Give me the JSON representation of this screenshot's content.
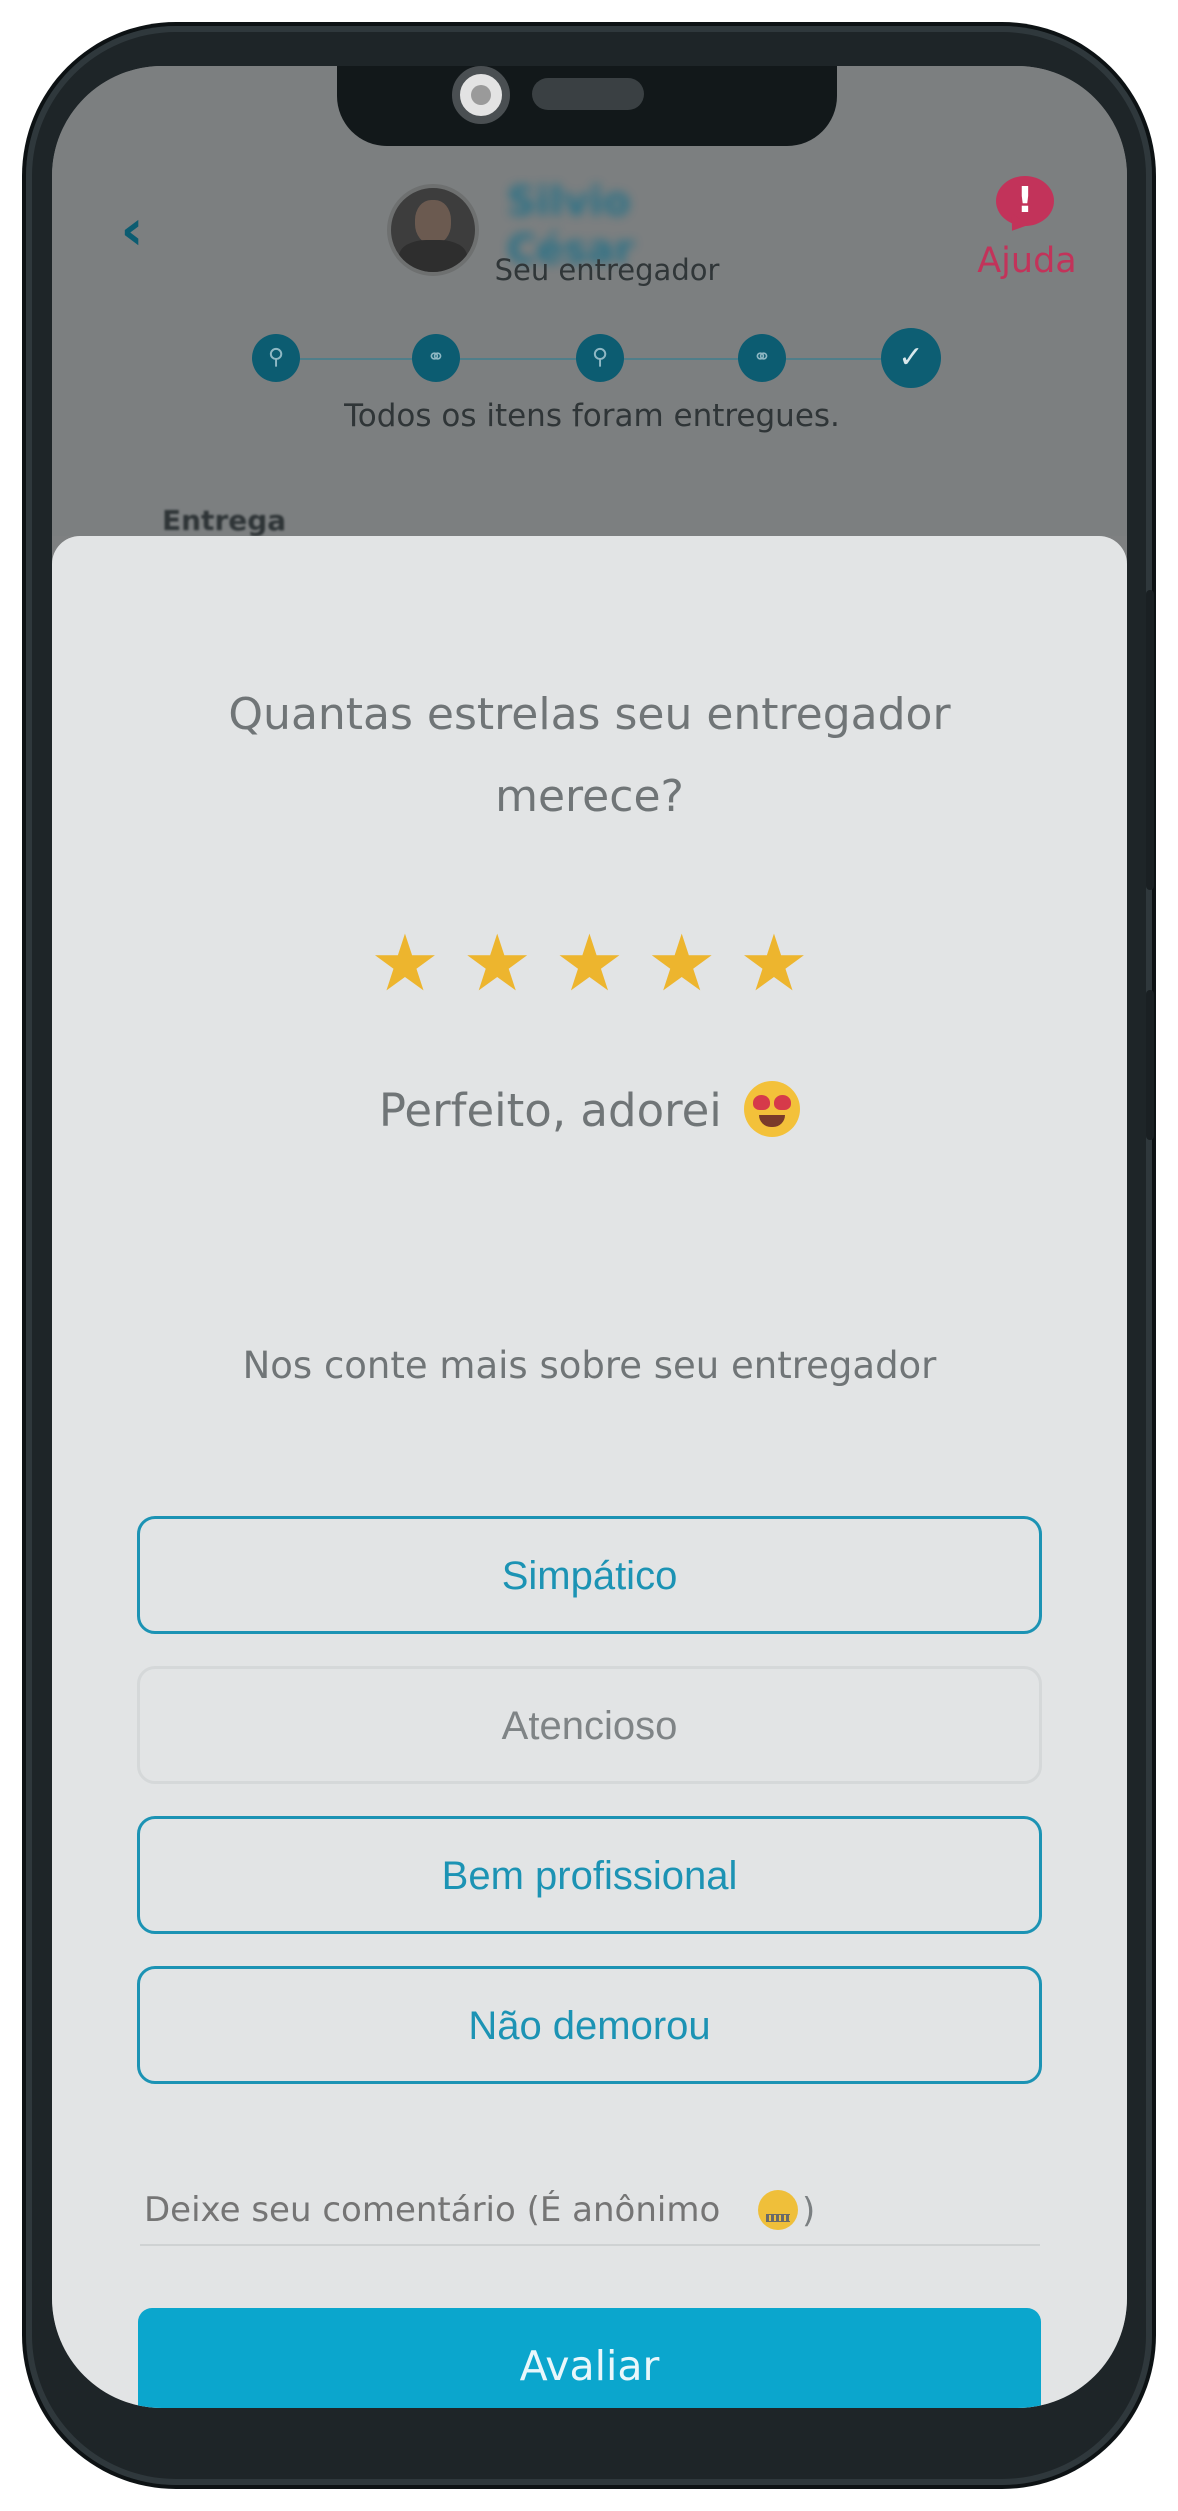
{
  "header": {
    "courier_name": "Silvio César",
    "courier_subtitle": "Seu entregador",
    "help_label": "Ajuda",
    "status_text": "Todos os itens foram entregues.",
    "peek_text": "Entrega"
  },
  "rating": {
    "question": "Quantas estrelas seu entregador merece?",
    "stars_selected": 5,
    "stars_total": 5,
    "stars": [
      "★",
      "★",
      "★",
      "★",
      "★"
    ],
    "label": "Perfeito, adorei",
    "label_emoji": "heart-eyes-emoji"
  },
  "feedback": {
    "title": "Nos conte mais sobre seu entregador",
    "tags": [
      {
        "label": "Simpático",
        "selected": true
      },
      {
        "label": "Atencioso",
        "selected": false
      },
      {
        "label": "Bem profissional",
        "selected": true
      },
      {
        "label": "Não demorou",
        "selected": true
      }
    ]
  },
  "comment": {
    "placeholder": "Deixe seu comentário (É anônimo",
    "placeholder_end": ")",
    "emoji": "zipper-mouth-emoji"
  },
  "submit_label": "Avaliar",
  "icons": {
    "back": "‹",
    "help": "!",
    "steps": [
      "⚲",
      "⚭",
      "⚲",
      "⚭",
      "✓"
    ]
  },
  "colors": {
    "accent": "#1c93b4",
    "primary_button": "#0ba6cd",
    "star": "#edb52e",
    "help": "#c2335a",
    "tracker_dark": "#0c5c71"
  }
}
